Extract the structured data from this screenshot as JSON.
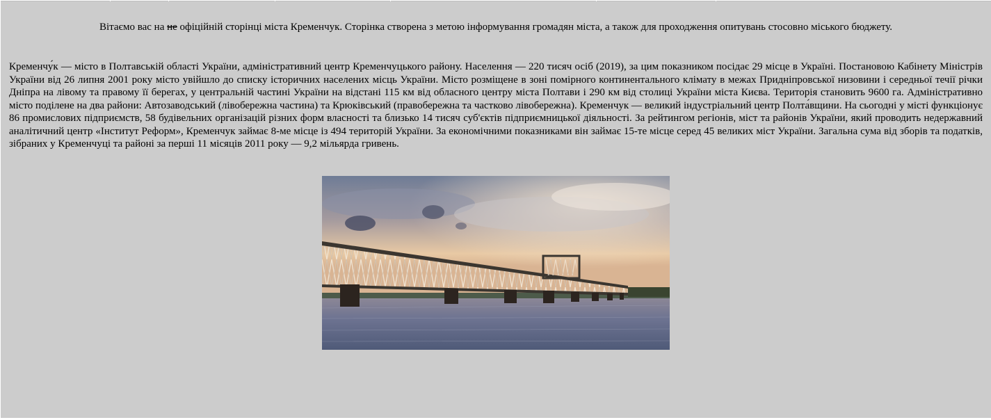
{
  "header": {
    "greeting_before": "Вітаємо вас на ",
    "greeting_struck": "не",
    "greeting_after": " офіційній сторінці міста Кременчук. Сторінка створена з метою інформування громадян міста, а також для проходження опитувань стосовно міського бюджету."
  },
  "main": {
    "description": "Кременчу́к — місто в Полтавській області України, адміністративний центр Кременчуцького району. Населення — 220 тисяч осіб (2019), за цим показником посідає 29 місце в Україні. Постановою Кабінету Міністрів України від 26 липня 2001 року місто увійшло до списку історичних населених місць України. Місто розміщене в зоні помірного континентального клімату в межах Придніпровської низовини і середньої течії річки Дніпра на лівому та правому її берегах, у центральній частині України на відстані 115 км від обласного центру міста Полтави і 290 км від столиці України міста Києва. Територія становить 9600 га. Адміністративно місто поділене на два райони: Автозаводський (лівобережна частина) та Крюківський (правобережна та частково лівобережна). Кременчук — великий індустріальний центр Полта́вщини. На сьогодні у місті функціонує 86 промислових підприємств, 58 будівельних організацій різних форм власності та близько 14 тисяч суб'єктів підприємницької діяльності. За рейтингом регіонів, міст та районів України, який проводить недержавний аналітичний центр «Інститут Реформ», Кременчук займає 8-ме місце із 494 територій України. За економічними показниками він займає 15-те місце серед 45 великих міст України. Загальна сума від зборів та податків, зібраних у Кременчуці та районі за перші 11 місяців 2011 року — 9,2 мільярда гривень."
  },
  "colors": {
    "page_background": "#cccccc",
    "text": "#000000",
    "sky_top": "#6f7c96",
    "sky_glow": "#e8c9a4",
    "water": "#5e6a86",
    "bridge": "#3b3630"
  },
  "icons": {
    "photo": "bridge-photo"
  }
}
